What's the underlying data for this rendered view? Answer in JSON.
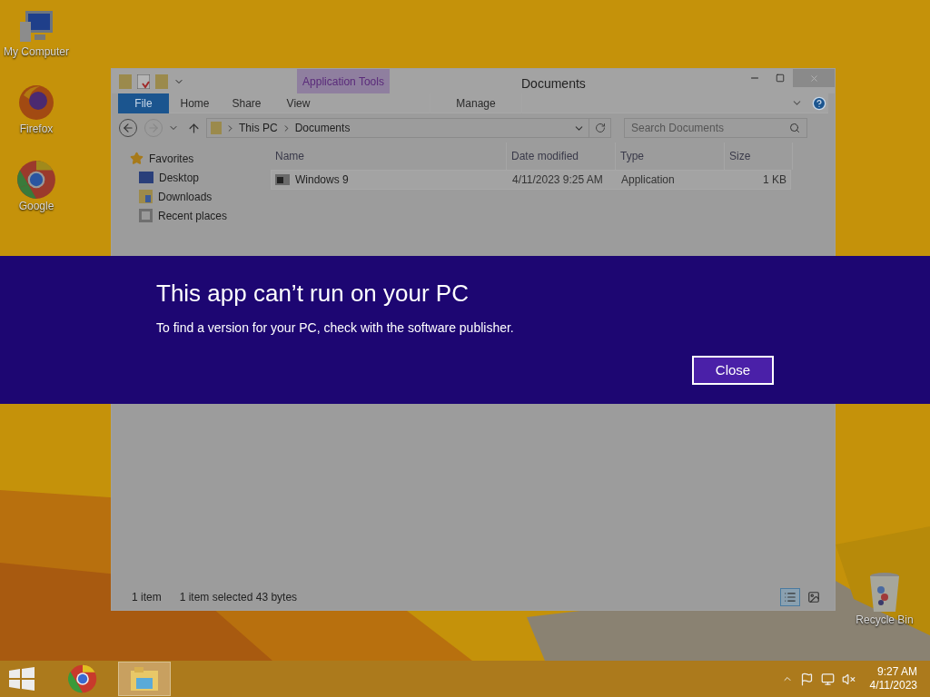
{
  "desktop_icons": [
    {
      "kind": "computer",
      "label": "My Computer"
    },
    {
      "kind": "firefox",
      "label": "Firefox"
    },
    {
      "kind": "chrome",
      "label": "Google"
    },
    {
      "kind": "recycle",
      "label": "Recycle Bin"
    }
  ],
  "window": {
    "title": "Documents",
    "contextual_group": "Application Tools",
    "ribbon_tabs": [
      {
        "kind": "file",
        "label": "File"
      },
      {
        "kind": "tab",
        "label": "Home"
      },
      {
        "kind": "tab",
        "label": "Share"
      },
      {
        "kind": "tab",
        "label": "View"
      },
      {
        "kind": "contextual",
        "label": "Manage"
      }
    ],
    "address": [
      "This PC",
      "Documents"
    ],
    "search": {
      "placeholder": "Search Documents"
    },
    "navigation": [
      {
        "kind": "favorites",
        "label": "Favorites",
        "children": [
          {
            "kind": "desktop",
            "label": "Desktop"
          },
          {
            "kind": "downloads",
            "label": "Downloads"
          },
          {
            "kind": "recent",
            "label": "Recent places"
          }
        ]
      }
    ],
    "columns": [
      "Name",
      "Date modified",
      "Type",
      "Size"
    ],
    "rows": [
      {
        "name": "Windows 9",
        "date": "4/11/2023 9:25 AM",
        "type": "Application",
        "size": "1 KB",
        "selected": true
      }
    ],
    "status": [
      "1 item",
      "1 item selected  43 bytes"
    ],
    "views": [
      {
        "kind": "details",
        "selected": true
      },
      {
        "kind": "tiles",
        "selected": false
      }
    ]
  },
  "dialog": {
    "title": "This app can’t run on your PC",
    "message": "To find a version for your PC, check with the software publisher.",
    "button": "Close"
  },
  "taskbar": {
    "apps": [
      {
        "kind": "chrome",
        "selected": false
      },
      {
        "kind": "explorer",
        "selected": true
      }
    ],
    "time": "9:27 AM",
    "date": "4/11/2023"
  }
}
